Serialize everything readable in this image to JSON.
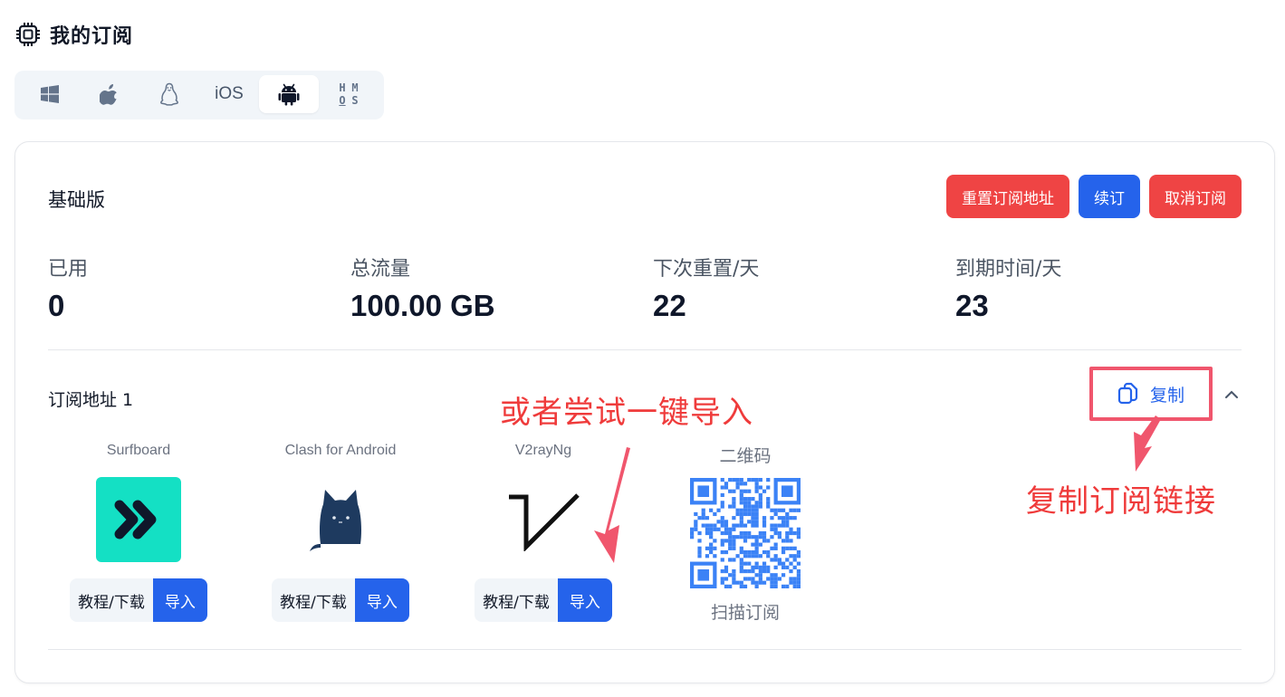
{
  "header": {
    "title": "我的订阅",
    "icon": "chip-icon"
  },
  "platforms": [
    {
      "name": "windows",
      "icon": "windows-icon",
      "active": false
    },
    {
      "name": "apple",
      "icon": "apple-icon",
      "active": false
    },
    {
      "name": "linux",
      "icon": "linux-icon",
      "active": false
    },
    {
      "name": "ios",
      "label": "iOS",
      "active": false
    },
    {
      "name": "android",
      "icon": "android-icon",
      "active": true
    },
    {
      "name": "hmos",
      "letters": [
        "H",
        "M",
        "O",
        "S"
      ],
      "active": false
    }
  ],
  "plan": {
    "name": "基础版",
    "actions": {
      "reset": "重置订阅地址",
      "renew": "续订",
      "cancel": "取消订阅"
    }
  },
  "stats": [
    {
      "label": "已用",
      "value": "0"
    },
    {
      "label": "总流量",
      "value": "100.00 GB"
    },
    {
      "label": "下次重置/天",
      "value": "22"
    },
    {
      "label": "到期时间/天",
      "value": "23"
    }
  ],
  "subscription": {
    "label": "订阅地址 1",
    "copy": "复制",
    "apps": [
      {
        "name": "Surfboard",
        "tutorial": "教程/下载",
        "import": "导入"
      },
      {
        "name": "Clash for Android",
        "tutorial": "教程/下载",
        "import": "导入"
      },
      {
        "name": "V2rayNg",
        "tutorial": "教程/下载",
        "import": "导入"
      }
    ],
    "qr": {
      "title": "二维码",
      "caption": "扫描订阅"
    }
  },
  "annotations": {
    "one_click": "或者尝试一键导入",
    "copy_link": "复制订阅链接",
    "color": "#ef3b3b"
  },
  "colors": {
    "primary": "#2563eb",
    "danger": "#ef4444",
    "highlight": "#f0566d",
    "surfboard": "#14e0c4",
    "qr": "#3b82f6"
  }
}
